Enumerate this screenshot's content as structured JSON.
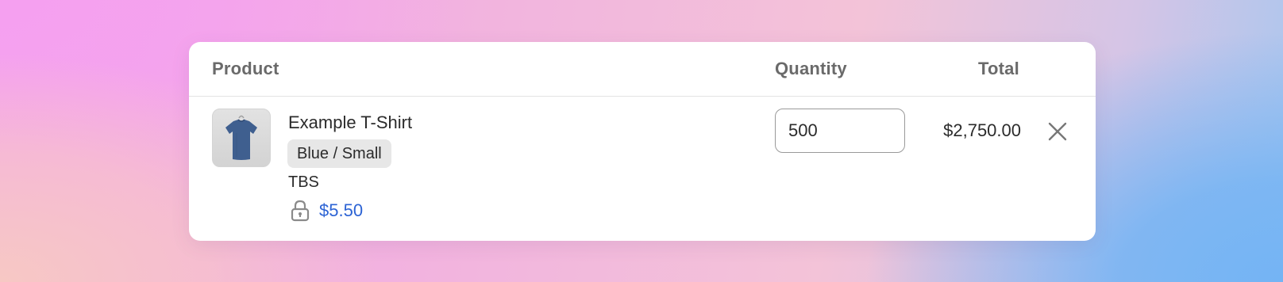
{
  "header": {
    "product_label": "Product",
    "quantity_label": "Quantity",
    "total_label": "Total"
  },
  "line_item": {
    "title": "Example T-Shirt",
    "variant": "Blue / Small",
    "sku": "TBS",
    "unit_price": "$5.50",
    "quantity": "500",
    "total": "$2,750.00",
    "image_icon": "tshirt-image",
    "lock_icon": "lock-icon",
    "remove_icon": "close-icon"
  },
  "colors": {
    "price_link": "#2c63d4",
    "tshirt": "#3f5f8f",
    "card_bg": "#ffffff"
  }
}
